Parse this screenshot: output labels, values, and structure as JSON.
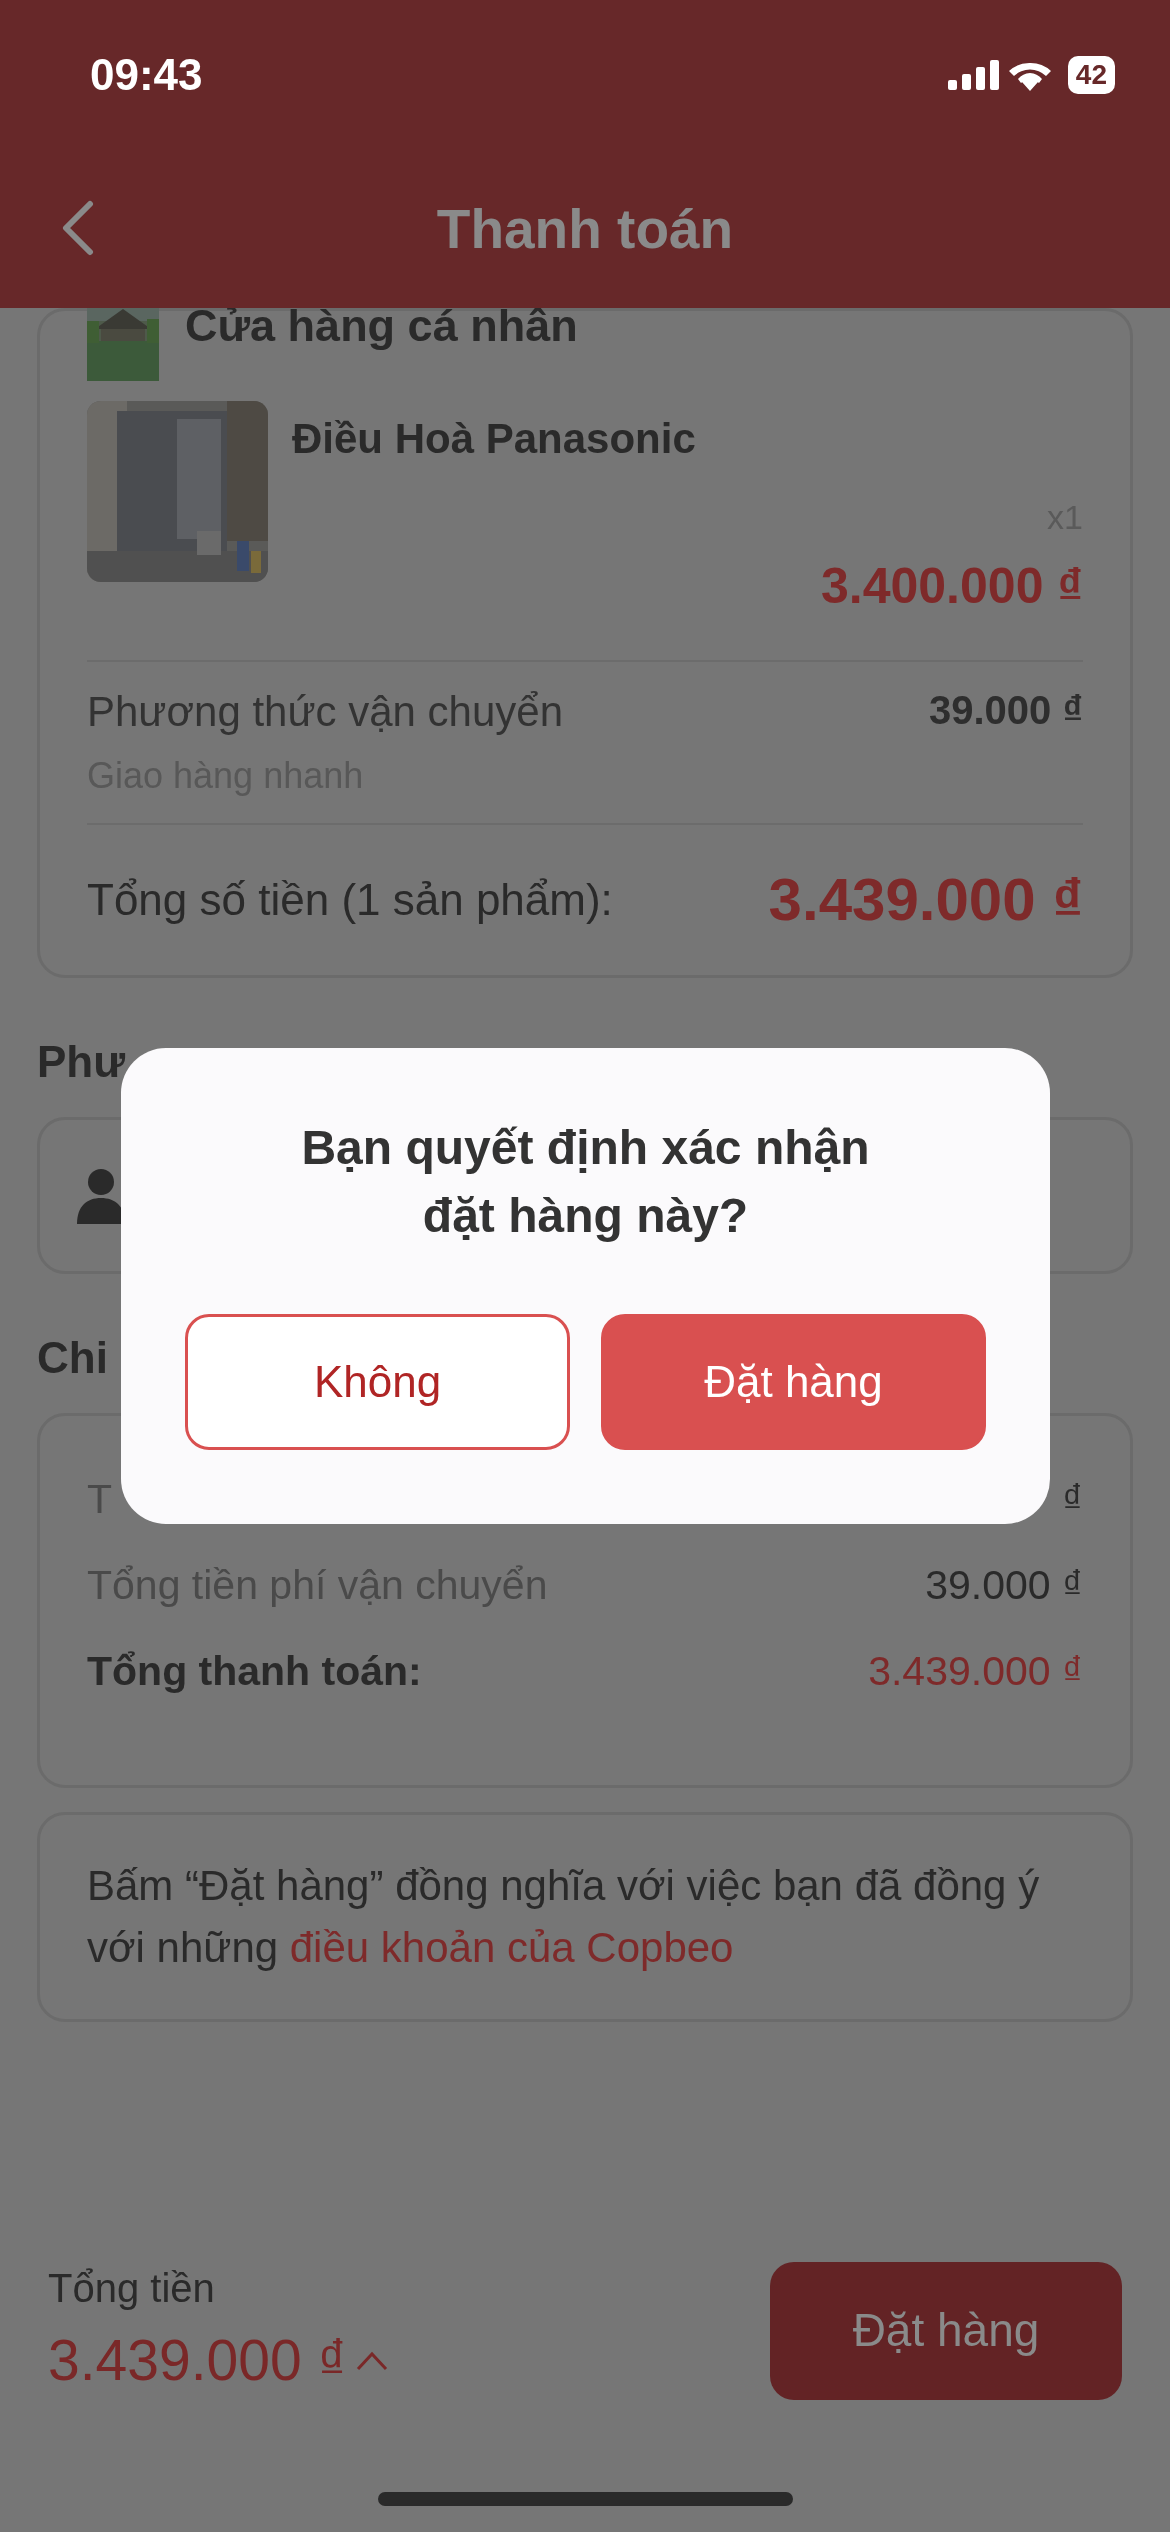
{
  "status_bar": {
    "time": "09:43",
    "battery": "42"
  },
  "header": {
    "title": "Thanh toán"
  },
  "order": {
    "store_name": "Cửa hàng cá nhân",
    "product": {
      "name": "Điều Hoà Panasonic",
      "quantity": "x1",
      "price": "3.400.000 ₫"
    },
    "shipping": {
      "label": "Phương thức vận chuyển",
      "method": "Giao hàng nhanh",
      "fee": "39.000 ₫"
    },
    "total": {
      "label": "Tổng số tiền (1 sản phẩm):",
      "amount": "3.439.000 ₫"
    }
  },
  "payment_section": {
    "heading": "Phư"
  },
  "details_section": {
    "heading": "Chi",
    "rows": [
      {
        "label": "T",
        "value": "₫",
        "kind": "plain"
      },
      {
        "label": "Tổng tiền phí vận chuyển",
        "value": "39.000 ₫",
        "kind": "plain"
      },
      {
        "label": "Tổng thanh toán:",
        "value": "3.439.000 ₫",
        "kind": "total"
      }
    ]
  },
  "terms": {
    "text": "Bấm “Đặt hàng” đồng nghĩa với việc bạn đã đồng ý với những",
    "link": "điều khoản của Copbeo"
  },
  "bottom_bar": {
    "label": "Tổng tiền",
    "amount": "3.439.000 ₫",
    "button": "Đặt hàng"
  },
  "dialog": {
    "message": "Bạn quyết định xác nhận đặt hàng này?",
    "buttons": [
      {
        "label": "Không",
        "kind": "secondary"
      },
      {
        "label": "Đặt hàng",
        "kind": "primary"
      }
    ]
  }
}
